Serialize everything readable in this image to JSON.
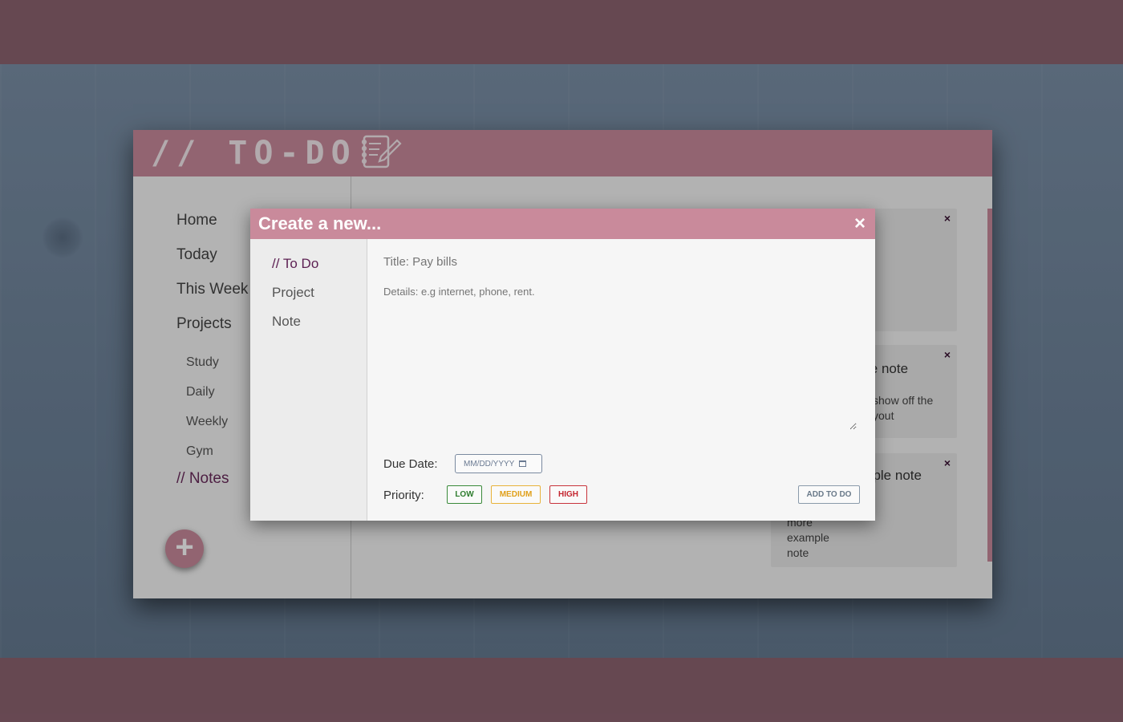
{
  "app": {
    "title": "// TO-DO",
    "logo_icon": "notebook-pencil-icon",
    "header_color": "#c98a9b"
  },
  "sidebar": {
    "items": [
      {
        "label": "Home"
      },
      {
        "label": "Today"
      },
      {
        "label": "This Week"
      },
      {
        "label": "Projects"
      },
      {
        "label": "Study"
      },
      {
        "label": "Daily"
      },
      {
        "label": "Weekly"
      },
      {
        "label": "Gym"
      },
      {
        "label": "// Notes"
      }
    ],
    "fab_label": "+"
  },
  "content": {
    "cards": [
      {
        "title": "",
        "text": "",
        "close": "×"
      },
      {
        "title": "le note",
        "text": "show off the\nyout",
        "close": "×"
      },
      {
        "title": "nple note",
        "text": "more\nexample\nnote",
        "close": "×"
      }
    ]
  },
  "modal": {
    "title": "Create a new...",
    "close": "×",
    "nav": [
      "// To Do",
      "Project",
      "Note"
    ],
    "title_placeholder": "Title: Pay bills",
    "details_placeholder": "Details: e.g internet, phone, rent.",
    "due_date_label": "Due Date:",
    "date_placeholder": "MM/DD/YYYY",
    "priority_label": "Priority:",
    "priorities": [
      "LOW",
      "MEDIUM",
      "HIGH"
    ],
    "submit_label": "ADD TO DO"
  },
  "colors": {
    "accent": "#c98a9b",
    "active_text": "#5c1f52",
    "low": "#2e7d2e",
    "medium": "#e0a01a",
    "high": "#c42630"
  }
}
